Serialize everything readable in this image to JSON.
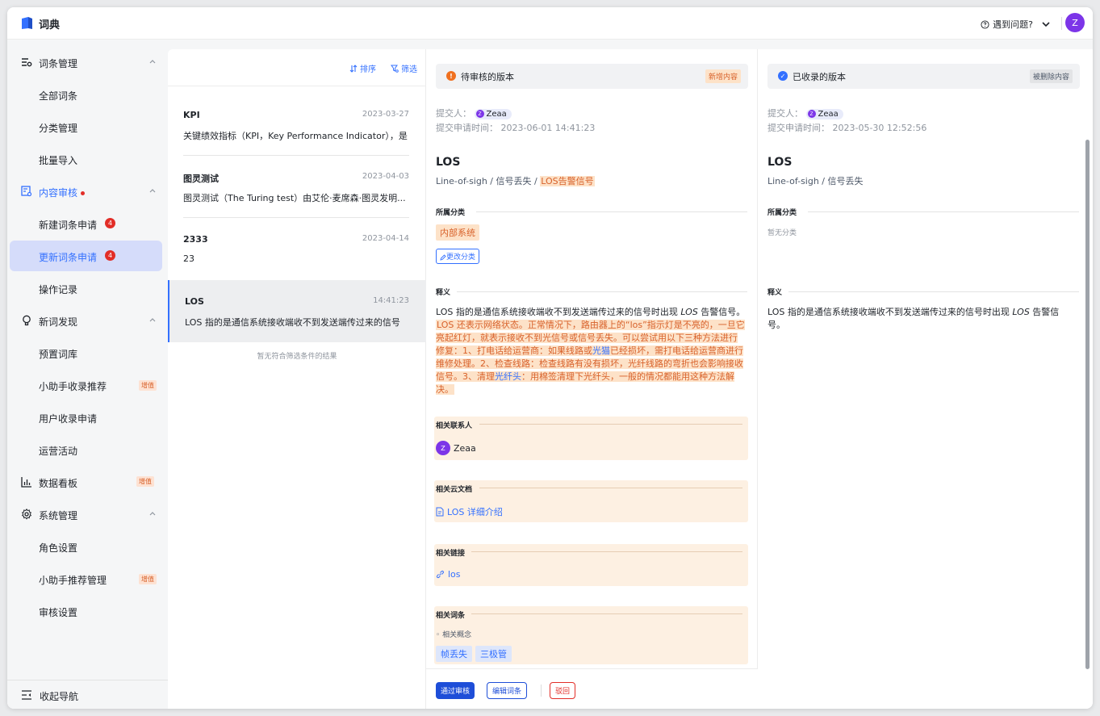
{
  "app": {
    "title": "词典"
  },
  "header": {
    "help_label": "遇到问题?",
    "user_initial": "Z"
  },
  "colors": {
    "brand": "#3370ff",
    "avatar": "#7c35e8",
    "highlight": "#fde2c8",
    "danger": "#e22e28"
  },
  "sidebar": {
    "groups": [
      {
        "label": "词条管理",
        "icon": "list-icon",
        "items": [
          "全部词条",
          "分类管理",
          "批量导入"
        ]
      },
      {
        "label": "内容审核",
        "icon": "review-icon",
        "has_dot": true,
        "items": [
          "新建词条申请",
          "更新词条申请",
          "操作记录"
        ],
        "badges": [
          "4",
          "4",
          ""
        ]
      },
      {
        "label": "新词发现",
        "icon": "bulb-icon",
        "items": [
          "预置词库",
          "小助手收录推荐",
          "用户收录申请",
          "运营活动"
        ]
      },
      {
        "label": "数据看板",
        "icon": "chart-icon"
      },
      {
        "label": "系统管理",
        "icon": "gear-icon",
        "items": [
          "角色设置",
          "小助手推荐管理",
          "审核设置"
        ]
      }
    ],
    "paid_label": "增值",
    "collapse_label": "收起导航"
  },
  "list": {
    "sort_label": "排序",
    "filter_label": "筛选",
    "entries": [
      {
        "name": "KPI",
        "date": "2023-03-27",
        "desc": "关键绩效指标（KPI，Key Performance Indicator），是"
      },
      {
        "name": "图灵测试",
        "date": "2023-04-03",
        "desc": "图灵测试（The Turing test）由艾伦·麦席森·图灵发明..."
      },
      {
        "name": "2333",
        "date": "2023-04-14",
        "desc": "23"
      },
      {
        "name": "LOS",
        "date": "14:41:23",
        "desc": "LOS 指的是通信系统接收端收不到发送端传过来的信号"
      }
    ],
    "empty_text": "暂无符合筛选条件的结果"
  },
  "pending": {
    "title": "待审核的版本",
    "tag": "新增内容",
    "submitter_label": "提交人：",
    "submitter": "Zeaa",
    "time_label": "提交申请时间：",
    "time": "2023-06-01 14:41:23",
    "term": "LOS",
    "sub_plain": "Line-of-sigh / 信号丢失 / ",
    "sub_added": "LOS告警信号",
    "category_title": "所属分类",
    "category": "内部系统",
    "change_category": "更改分类",
    "definition_title": "释义",
    "def_prefix": "LOS 指的是通信系统接收端收不到发送端传过来的信号时出现 ",
    "def_em": "LOS",
    "def_mid": " 告警信号。",
    "def_added_1": "LOS 还表示网络状态。正常情况下，路由器上的“los”指示灯是不亮的，一旦它亮起红灯，就表示接收不到光信号或信号丢失。可以尝试用以下三种方法进行修复：1、打电话给运营商：如果线路或",
    "def_link_1": "光猫",
    "def_added_2": "已经损坏，需打电话给运营商进行维修处理。2、检查线路：检查线路有没有损坏，光纤线路的弯折也会影响接收信号。3、清理",
    "def_link_2": "光纤头",
    "def_added_3": "：用棉签清理下光纤头，一般的情况都能用这种方法解决。",
    "contacts_title": "相关联系人",
    "contact": "Zeaa",
    "docs_title": "相关云文档",
    "doc": "LOS 详细介绍",
    "links_title": "相关链接",
    "link": "los",
    "terms_title": "相关词条",
    "related_concept": "相关概念",
    "related_terms": [
      "帧丢失",
      "三极管"
    ],
    "approve": "通过审核",
    "edit": "编辑词条",
    "reject": "驳回"
  },
  "published": {
    "title": "已收录的版本",
    "tag": "被删除内容",
    "submitter_label": "提交人：",
    "submitter": "Zeaa",
    "time_label": "提交申请时间：",
    "time": "2023-05-30 12:52:56",
    "term": "LOS",
    "sub": "Line-of-sigh / 信号丢失",
    "category_title": "所属分类",
    "category_empty": "暂无分类",
    "definition_title": "释义",
    "def_prefix": "LOS 指的是通信系统接收端收不到发送端传过来的信号时出现 ",
    "def_em": "LOS",
    "def_suffix": " 告警信号。"
  }
}
